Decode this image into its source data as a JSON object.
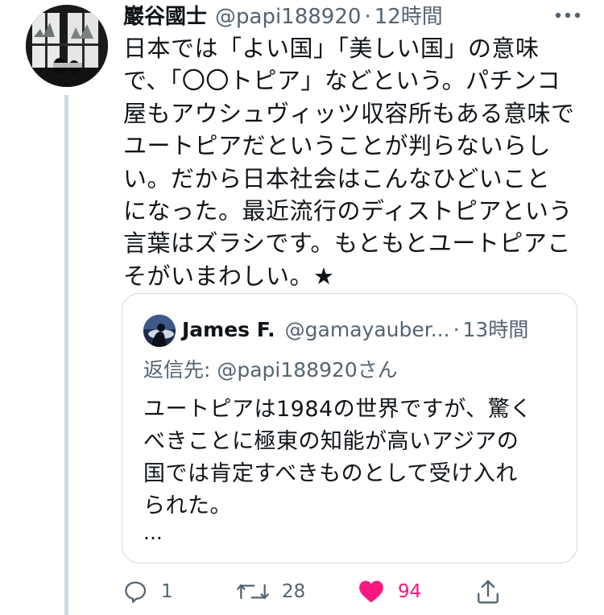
{
  "tweet": {
    "author": {
      "display_name": "巖谷國士",
      "handle": "@papi188920"
    },
    "separator": "·",
    "time": "12時間",
    "more_icon": "more-horizontal-icon",
    "text": "日本では「よい国」「美しい国」の意味\nで、「〇〇トピア」などという。パチンコ\n屋もアウシュヴィッツ収容所もある意味で\nユートピアだということが判らないらし\nい。だから日本社会はこんなひどいこと\nになった。最近流行のディストピアという\n言葉はズラシです。もともとユートピアこ\nそがいまわしい。★"
  },
  "quote": {
    "author": {
      "display_name": "James F.",
      "handle": "@gamayauber..."
    },
    "separator": "·",
    "time": "13時間",
    "reply_to": "返信先: @papi188920さん",
    "text": "ユートピアは1984の世界ですが、驚く\nべきことに極東の知能が高いアジアの\n国では肯定すべきものとして受け入れ\nられた。",
    "ellipsis": "..."
  },
  "actions": {
    "reply": {
      "icon": "reply-icon",
      "count": "1"
    },
    "retweet": {
      "icon": "retweet-icon",
      "count": "28"
    },
    "like": {
      "icon": "heart-filled-icon",
      "count": "94",
      "color": "#f91880"
    },
    "share": {
      "icon": "share-icon"
    }
  },
  "colors": {
    "text": "#0f1419",
    "secondary": "#536471",
    "border": "#cfd9de",
    "like": "#f91880"
  }
}
